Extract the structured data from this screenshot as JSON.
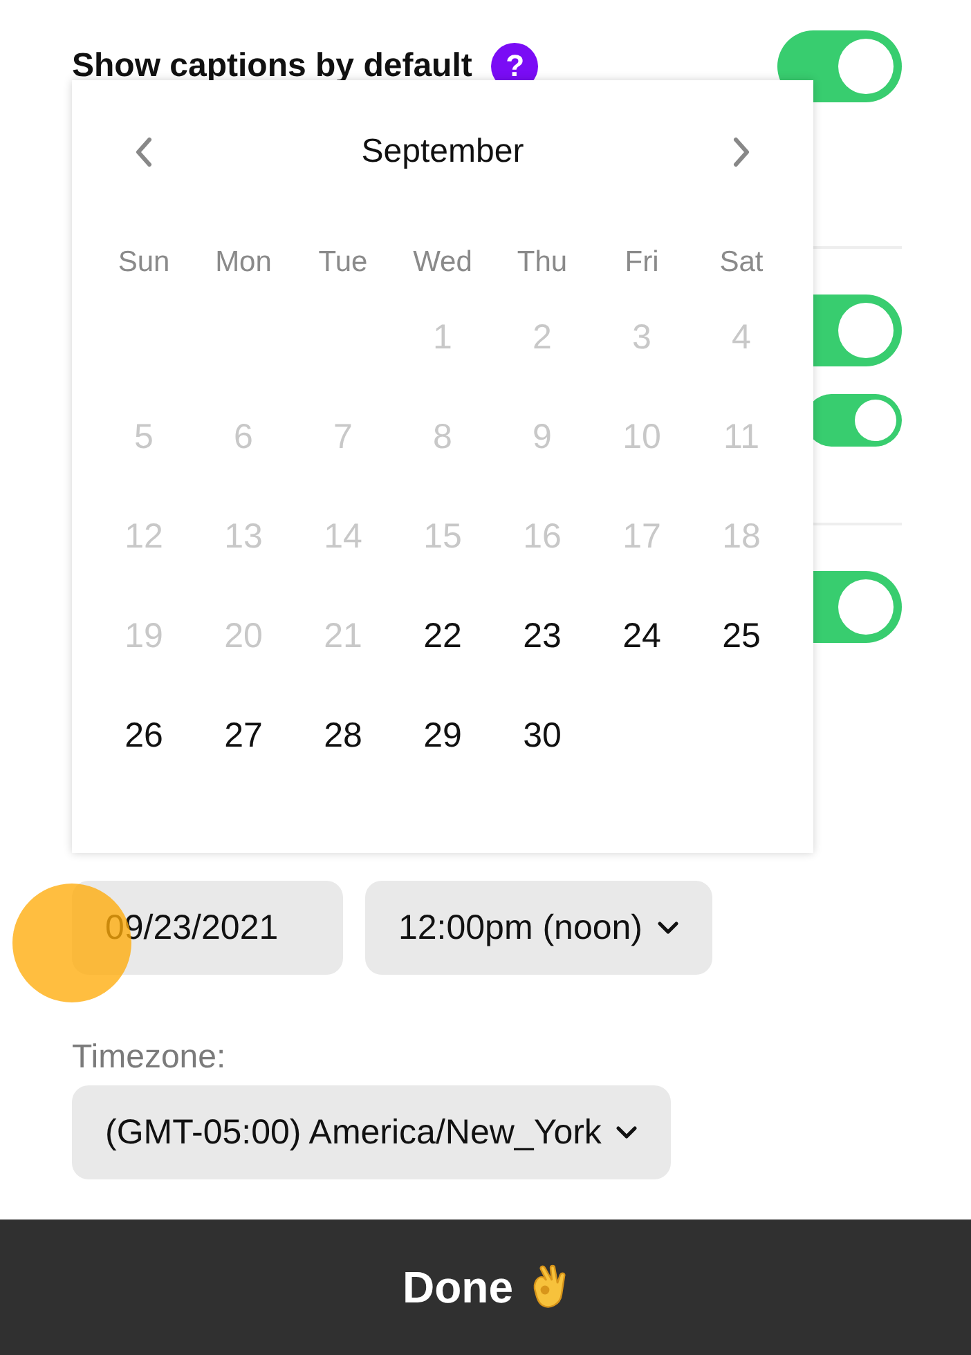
{
  "setting": {
    "label": "Show captions by default",
    "help_icon": "?",
    "on": true
  },
  "toggles": [
    {
      "kind": "large",
      "on": true
    },
    {
      "kind": "small",
      "on": true
    },
    {
      "kind": "large",
      "on": true
    }
  ],
  "calendar": {
    "month": "September",
    "weekdays": [
      "Sun",
      "Mon",
      "Tue",
      "Wed",
      "Thu",
      "Fri",
      "Sat"
    ],
    "weeks": [
      [
        {
          "day": "1",
          "disabled": true
        },
        {
          "day": "2",
          "disabled": true
        },
        {
          "day": "3",
          "disabled": true
        },
        {
          "day": "4",
          "disabled": true
        }
      ],
      [
        {
          "day": "5",
          "disabled": true
        },
        {
          "day": "6",
          "disabled": true
        },
        {
          "day": "7",
          "disabled": true
        },
        {
          "day": "8",
          "disabled": true
        },
        {
          "day": "9",
          "disabled": true
        },
        {
          "day": "10",
          "disabled": true
        },
        {
          "day": "11",
          "disabled": true
        }
      ],
      [
        {
          "day": "12",
          "disabled": true
        },
        {
          "day": "13",
          "disabled": true
        },
        {
          "day": "14",
          "disabled": true
        },
        {
          "day": "15",
          "disabled": true
        },
        {
          "day": "16",
          "disabled": true
        },
        {
          "day": "17",
          "disabled": true
        },
        {
          "day": "18",
          "disabled": true
        }
      ],
      [
        {
          "day": "19",
          "disabled": true
        },
        {
          "day": "20",
          "disabled": true
        },
        {
          "day": "21",
          "disabled": true
        },
        {
          "day": "22",
          "disabled": false
        },
        {
          "day": "23",
          "disabled": false
        },
        {
          "day": "24",
          "disabled": false
        },
        {
          "day": "25",
          "disabled": false
        }
      ],
      [
        {
          "day": "26",
          "disabled": false
        },
        {
          "day": "27",
          "disabled": false
        },
        {
          "day": "28",
          "disabled": false
        },
        {
          "day": "29",
          "disabled": false
        },
        {
          "day": "30",
          "disabled": false
        }
      ]
    ]
  },
  "date_field": {
    "value": "09/23/2021"
  },
  "time_select": {
    "value": "12:00pm (noon)"
  },
  "timezone": {
    "label": "Timezone:",
    "value": "(GMT-05:00) America/New_York"
  },
  "done_button": {
    "label": "Done"
  }
}
